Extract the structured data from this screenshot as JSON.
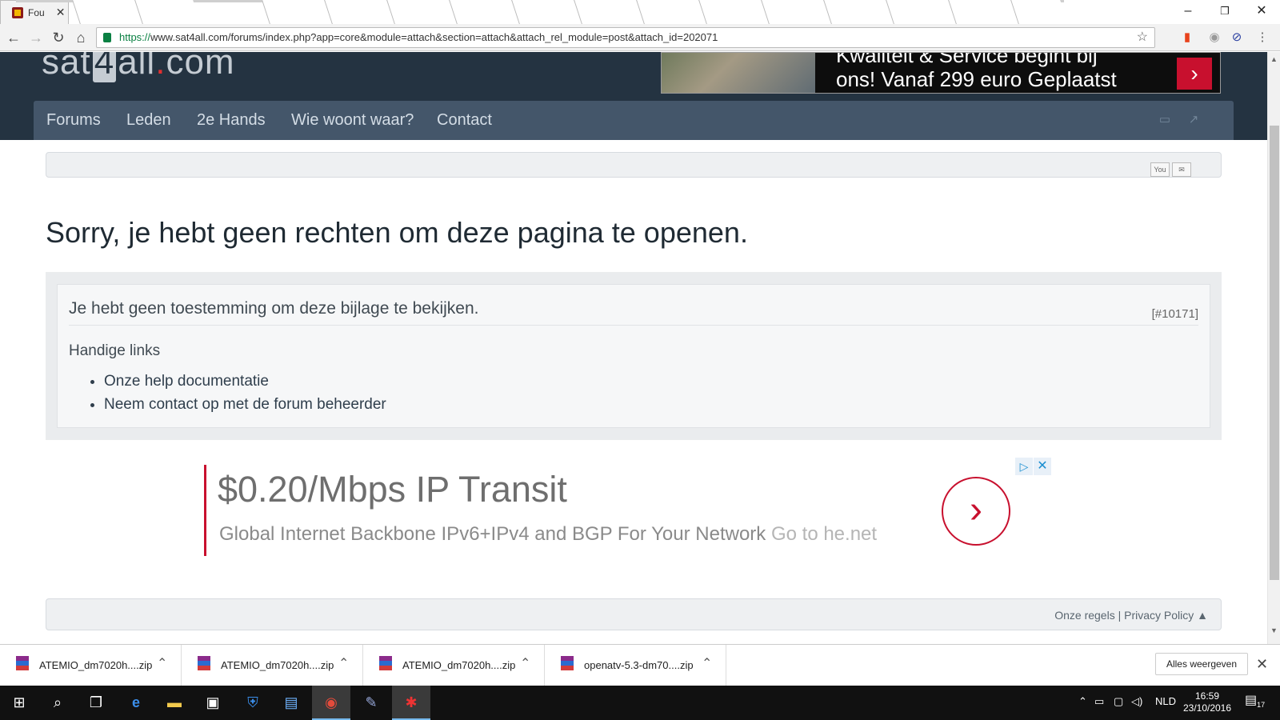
{
  "browser": {
    "active_tab_title": "Fou",
    "address_scheme": "https://",
    "address_rest": "www.sat4all.com/forums/index.php?app=core&module=attach&section=attach&attach_rel_module=post&attach_id=202071",
    "window_controls": {
      "minimize": "–",
      "restore": "❐",
      "close": "✕"
    }
  },
  "site": {
    "logo_left": "sat",
    "logo_four": "4",
    "logo_mid": "all",
    "logo_dot": ".",
    "logo_right": "com",
    "banner_line1": "Kwaliteit & Service begint bij",
    "banner_line2": "ons! Vanaf 299 euro Geplaatst",
    "nav": [
      "Forums",
      "Leden",
      "2e Hands",
      "Wie woont waar?",
      "Contact"
    ]
  },
  "error": {
    "title": "Sorry, je hebt geen rechten om deze pagina te openen.",
    "message": "Je hebt geen toestemming om deze bijlage te bekijken.",
    "code": "[#10171]",
    "links_heading": "Handige links",
    "links": [
      "Onze help documentatie",
      "Neem contact op met de forum beheerder"
    ]
  },
  "ad": {
    "title": "$0.20/Mbps IP Transit",
    "description": "Global Internet Backbone IPv6+IPv4 and BGP For Your Network",
    "link_text": "Go to he.net"
  },
  "footer": {
    "text": "Onze regels | Privacy Policy ▲"
  },
  "downloads": {
    "items": [
      "ATEMIO_dm7020h....zip",
      "ATEMIO_dm7020h....zip",
      "ATEMIO_dm7020h....zip",
      "openatv-5.3-dm70....zip"
    ],
    "show_all": "Alles weergeven"
  },
  "taskbar": {
    "language": "NLD",
    "time": "16:59",
    "date": "23/10/2016",
    "notification_count": "17"
  },
  "colors": {
    "header_bg": "#243341",
    "nav_bg": "#44566a",
    "ad_accent": "#c8102e"
  }
}
